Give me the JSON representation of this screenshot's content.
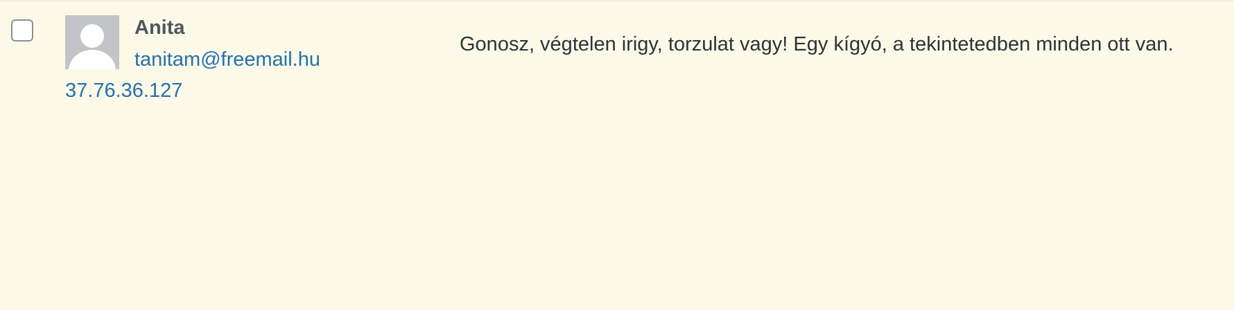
{
  "comment": {
    "author": {
      "name": "Anita",
      "email": "tanitam@freemail.hu",
      "ip": "37.76.36.127",
      "avatar_icon": "default-avatar-icon"
    },
    "text": "Gonosz, végtelen irigy, torzulat vagy! Egy kígyó, a tekintetedben minden ott van."
  },
  "colors": {
    "row_background": "#fcf9e8",
    "link": "#2271b1",
    "author_name": "#50575e",
    "text": "#2c3338",
    "avatar_bg": "#c3c4c7"
  }
}
